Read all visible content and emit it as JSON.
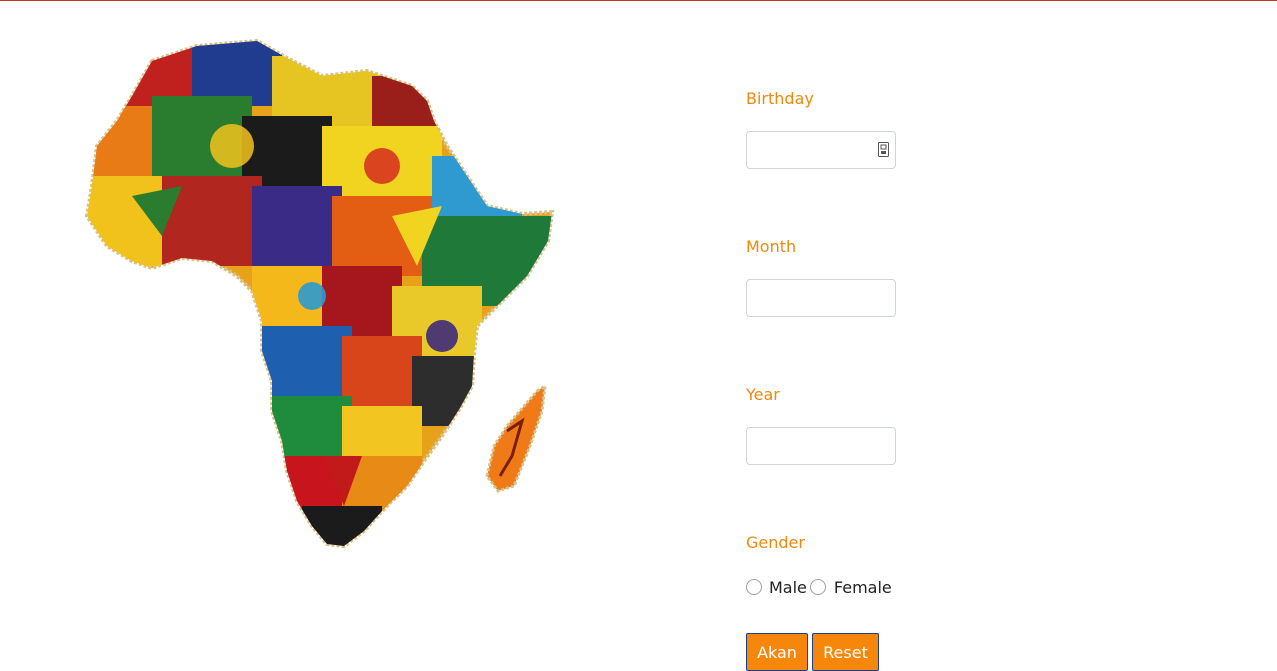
{
  "image": {
    "icon": "africa-map-illustration"
  },
  "form": {
    "birthday": {
      "label": "Birthday",
      "value": "",
      "icon": "calendar-icon"
    },
    "month": {
      "label": "Month",
      "value": ""
    },
    "year": {
      "label": "Year",
      "value": ""
    },
    "gender": {
      "label": "Gender",
      "options": [
        {
          "label": "Male",
          "selected": false
        },
        {
          "label": "Female",
          "selected": false
        }
      ]
    },
    "buttons": {
      "submit_label": "Akan",
      "reset_label": "Reset"
    }
  },
  "colors": {
    "accent": "#f0880c",
    "button_bg": "#f7870b",
    "button_border": "#1a3f8f",
    "top_rule": "#c0392b"
  }
}
